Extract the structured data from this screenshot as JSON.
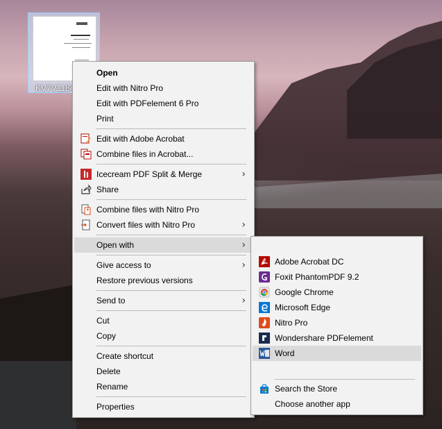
{
  "desktop": {
    "file": {
      "label": "KV7V1184"
    }
  },
  "context_menu": {
    "items": {
      "open": "Open",
      "edit_nitro": "Edit with Nitro Pro",
      "edit_pdfelement": "Edit with PDFelement 6 Pro",
      "print": "Print",
      "edit_acrobat": "Edit with Adobe Acrobat",
      "combine_acrobat": "Combine files in Acrobat...",
      "icecream": "Icecream PDF Split & Merge",
      "share": "Share",
      "combine_nitro": "Combine files with Nitro Pro",
      "convert_nitro": "Convert files with Nitro Pro",
      "open_with": "Open with",
      "give_access": "Give access to",
      "restore": "Restore previous versions",
      "send_to": "Send to",
      "cut": "Cut",
      "copy": "Copy",
      "create_shortcut": "Create shortcut",
      "delete": "Delete",
      "rename": "Rename",
      "properties": "Properties"
    }
  },
  "open_with_menu": {
    "items": {
      "acrobat_dc": "Adobe Acrobat DC",
      "foxit": "Foxit PhantomPDF 9.2",
      "chrome": "Google Chrome",
      "edge": "Microsoft Edge",
      "nitro": "Nitro Pro",
      "wondershare": "Wondershare PDFelement",
      "word": "Word",
      "store": "Search the Store",
      "choose": "Choose another app"
    }
  },
  "colors": {
    "menu_bg": "#f2f2f2",
    "highlight": "#dadada",
    "acrobat_red": "#b30b00",
    "foxit_purple": "#6a2c91",
    "edge_blue": "#0078d7",
    "nitro_red": "#e04b1b",
    "word_blue": "#2b579a",
    "store_blue": "#0078d7"
  }
}
